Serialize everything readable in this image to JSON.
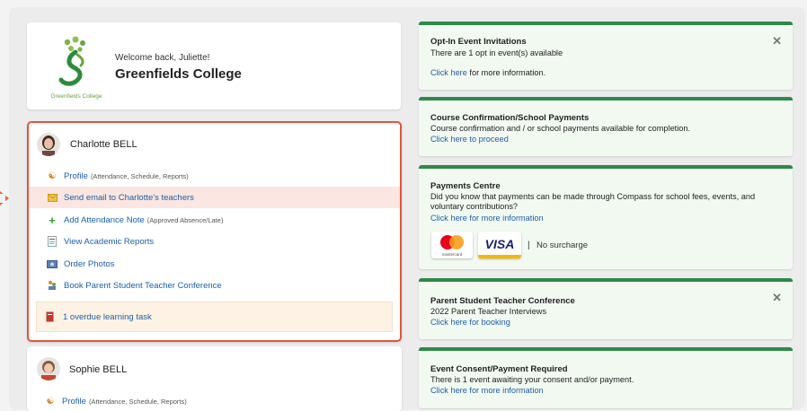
{
  "school": {
    "welcome": "Welcome back, Juliette!",
    "name": "Greenfields College",
    "logo_text": "Greenfields College"
  },
  "student1": {
    "name": "Charlotte BELL",
    "links": [
      {
        "label": "Profile",
        "note": "(Attendance, Schedule, Reports)",
        "icon": "person-icon"
      },
      {
        "label": "Send email to Charlotte's teachers",
        "note": "",
        "icon": "envelope-icon"
      },
      {
        "label": "Add Attendance Note",
        "note": "(Approved Absence/Late)",
        "icon": "plus-icon"
      },
      {
        "label": "View Academic Reports",
        "note": "",
        "icon": "report-icon"
      },
      {
        "label": "Order Photos",
        "note": "",
        "icon": "photo-icon"
      },
      {
        "label": "Book Parent Student Teacher Conference",
        "note": "",
        "icon": "conference-icon"
      }
    ],
    "task": "1 overdue learning task"
  },
  "student2": {
    "name": "Sophie BELL",
    "links": [
      {
        "label": "Profile",
        "note": "(Attendance, Schedule, Reports)",
        "icon": "person-icon"
      }
    ]
  },
  "notices": {
    "optin": {
      "title": "Opt-In Event Invitations",
      "text": "There are 1 opt in event(s) available",
      "link": "Click here",
      "link_rest": " for more information."
    },
    "course": {
      "title": "Course Confirmation/School Payments",
      "text": "Course confirmation and / or school payments available for completion.",
      "link": "Click here to proceed"
    },
    "payments": {
      "title": "Payments Centre",
      "text": "Did you know that payments can be made through Compass for school fees, events, and voluntary contributions?",
      "link": "Click here for more information",
      "mastercard_label": "mastercard",
      "visa_label": "VISA",
      "surcharge": "No surcharge"
    },
    "conference": {
      "title": "Parent Student Teacher Conference",
      "text": "2022 Parent Teacher Interviews",
      "link": "Click here for booking"
    },
    "consent": {
      "title": "Event Consent/Payment Required",
      "text": "There is 1 event awaiting your consent and/or payment.",
      "link": "Click here for more information"
    }
  },
  "colors": {
    "accent_green": "#2d8a48",
    "highlight_border": "#e1563c",
    "link_blue": "#1d5fa8"
  }
}
